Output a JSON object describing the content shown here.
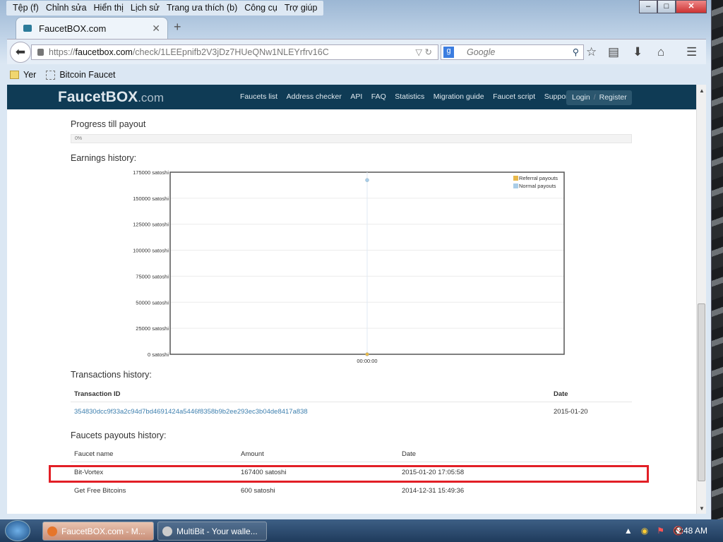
{
  "menu": [
    "Tệp (f)",
    "Chỉnh sửa",
    "Hiển thị",
    "Lịch sử",
    "Trang ưa thích (b)",
    "Công cụ",
    "Trợ giúp"
  ],
  "tab": {
    "title": "FaucetBOX.com"
  },
  "url": {
    "scheme": "https://",
    "host": "faucetbox.com",
    "path": "/check/1LEEpnifb2V3jDz7HUeQNw1NLEYrfrv16C"
  },
  "search": {
    "placeholder": "Google"
  },
  "bookmarks": [
    "Yer",
    "Bitcoin Faucet"
  ],
  "site": {
    "logo": "FaucetBOX",
    "logo_suffix": ".com",
    "nav": [
      "Faucets list",
      "Address checker",
      "API",
      "FAQ",
      "Statistics",
      "Migration guide",
      "Faucet script",
      "Support"
    ],
    "login": "Login",
    "register": "Register"
  },
  "progress": {
    "title": "Progress till payout",
    "label": "0%",
    "value": 0
  },
  "earnings": {
    "title": "Earnings history:"
  },
  "chart_data": {
    "type": "scatter",
    "title": "Earnings history:",
    "x": [
      "00:00:00"
    ],
    "yticks": [
      "0 satoshi",
      "25000 satoshi",
      "50000 satoshi",
      "75000 satoshi",
      "100000 satoshi",
      "125000 satoshi",
      "150000 satoshi",
      "175000 satoshi"
    ],
    "ylim": [
      0,
      175000
    ],
    "grid": true,
    "legend_position": "top-right",
    "series": [
      {
        "name": "Referral payouts",
        "color": "#e8b84a",
        "values": [
          0
        ]
      },
      {
        "name": "Normal payouts",
        "color": "#a9cde8",
        "values": [
          167400
        ]
      }
    ]
  },
  "transactions": {
    "title": "Transactions history:",
    "headers": [
      "Transaction ID",
      "Date"
    ],
    "rows": [
      [
        "354830dcc9f33a2c94d7bd4691424a5446f8358b9b2ee293ec3b04de8417a838",
        "2015-01-20"
      ]
    ]
  },
  "payouts": {
    "title": "Faucets payouts history:",
    "headers": [
      "Faucet name",
      "Amount",
      "Date"
    ],
    "rows": [
      [
        "Bit-Vortex",
        "167400 satoshi",
        "2015-01-20 17:05:58"
      ],
      [
        "Get Free Bitcoins",
        "600 satoshi",
        "2014-12-31 15:49:36"
      ]
    ]
  },
  "taskbar": {
    "items": [
      "FaucetBOX.com - M...",
      "MultiBit - Your walle..."
    ],
    "clock": "2:48 AM"
  }
}
